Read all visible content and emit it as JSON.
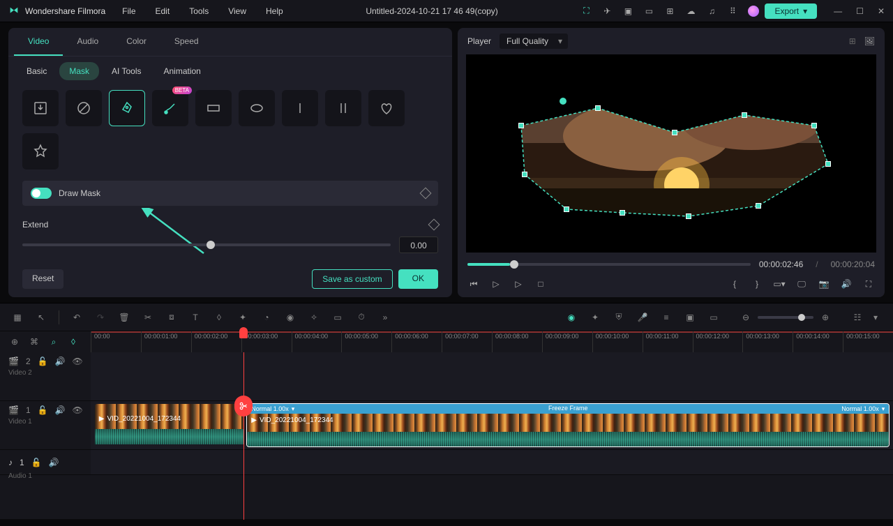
{
  "app": {
    "name": "Wondershare Filmora"
  },
  "menu": [
    "File",
    "Edit",
    "Tools",
    "View",
    "Help"
  ],
  "document": {
    "title": "Untitled-2024-10-21 17 46 49(copy)"
  },
  "export": {
    "label": "Export"
  },
  "left_panel": {
    "main_tabs": [
      "Video",
      "Audio",
      "Color",
      "Speed"
    ],
    "active_main_tab": "Video",
    "sub_tabs": [
      "Basic",
      "Mask",
      "AI Tools",
      "Animation"
    ],
    "active_sub_tab": "Mask",
    "mask_shapes": [
      "import",
      "none",
      "pen-draw",
      "brush-draw",
      "rectangle",
      "ellipse",
      "line-vertical",
      "line-double",
      "heart",
      "star"
    ],
    "active_shape": "pen-draw",
    "beta_shape": "brush-draw",
    "beta_badge": "BETA",
    "draw_mask": {
      "label": "Draw Mask",
      "enabled": true
    },
    "extend": {
      "label": "Extend",
      "value": "0.00"
    },
    "buttons": {
      "reset": "Reset",
      "save_custom": "Save as custom",
      "ok": "OK"
    }
  },
  "player": {
    "label": "Player",
    "quality": "Full Quality",
    "current_time": "00:00:02:46",
    "duration": "00:00:20:04",
    "progress_percent": 15
  },
  "timeline": {
    "ruler": [
      "00:00",
      "00:00:01:00",
      "00:00:02:00",
      "00:00:03:00",
      "00:00:04:00",
      "00:00:05:00",
      "00:00:06:00",
      "00:00:07:00",
      "00:00:08:00",
      "00:00:09:00",
      "00:00:10:00",
      "00:00:11:00",
      "00:00:12:00",
      "00:00:13:00",
      "00:00:14:00",
      "00:00:15:00"
    ],
    "playhead_percent": 19,
    "tracks": {
      "video2": {
        "icon_label": "2",
        "label": "Video 2"
      },
      "video1": {
        "icon_label": "1",
        "label": "Video 1",
        "clips": [
          {
            "name": "VID_20221004_172344",
            "speed": "",
            "start_pct": 0.5,
            "width_pct": 18.5,
            "selected": false
          },
          {
            "name": "VID_20221004_172344",
            "speed_left": "Normal 1.00x",
            "speed_right": "Normal 1.00x",
            "freeze": "Freeze Frame",
            "start_pct": 19.5,
            "width_pct": 80.5,
            "selected": true
          }
        ]
      },
      "audio1": {
        "icon_label": "1",
        "label": "Audio 1"
      }
    }
  },
  "colors": {
    "accent": "#45e0c0",
    "playhead": "#ff4040"
  }
}
